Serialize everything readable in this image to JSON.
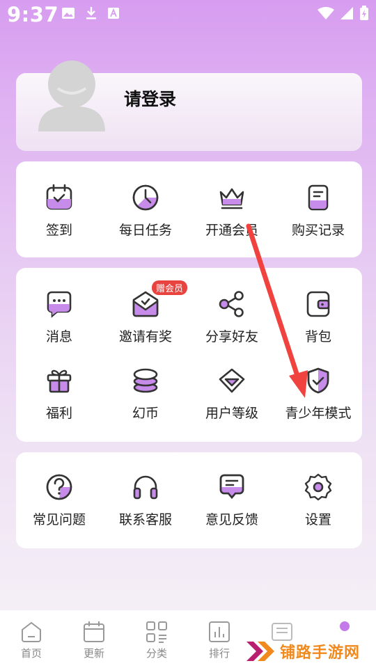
{
  "status_bar": {
    "time": "9:37"
  },
  "profile": {
    "login_label": "请登录"
  },
  "quick_actions": [
    {
      "label": "签到",
      "icon": "calendar-check-icon"
    },
    {
      "label": "每日任务",
      "icon": "clock-icon"
    },
    {
      "label": "开通会员",
      "icon": "crown-icon"
    },
    {
      "label": "购买记录",
      "icon": "receipt-icon"
    }
  ],
  "features_row1": [
    {
      "label": "消息",
      "icon": "message-icon"
    },
    {
      "label": "邀请有奖",
      "icon": "invite-mail-icon",
      "badge": "赠会员"
    },
    {
      "label": "分享好友",
      "icon": "share-icon"
    },
    {
      "label": "背包",
      "icon": "wallet-icon"
    }
  ],
  "features_row2": [
    {
      "label": "福利",
      "icon": "gift-icon"
    },
    {
      "label": "幻币",
      "icon": "coin-stack-icon"
    },
    {
      "label": "用户等级",
      "icon": "diamond-level-icon"
    },
    {
      "label": "青少年模式",
      "icon": "shield-check-icon"
    }
  ],
  "support": [
    {
      "label": "常见问题",
      "icon": "question-icon"
    },
    {
      "label": "联系客服",
      "icon": "headset-icon"
    },
    {
      "label": "意见反馈",
      "icon": "feedback-icon"
    },
    {
      "label": "设置",
      "icon": "gear-icon"
    }
  ],
  "bottom_nav": [
    {
      "label": "首页",
      "icon": "home-icon"
    },
    {
      "label": "更新",
      "icon": "calendar-icon"
    },
    {
      "label": "分类",
      "icon": "category-icon"
    },
    {
      "label": "排行",
      "icon": "ranking-icon"
    }
  ],
  "watermark": {
    "text": "铺路手游网"
  },
  "colors": {
    "accent": "#b86fe3",
    "arrow": "#f0433f",
    "badge": "#e8433f"
  }
}
